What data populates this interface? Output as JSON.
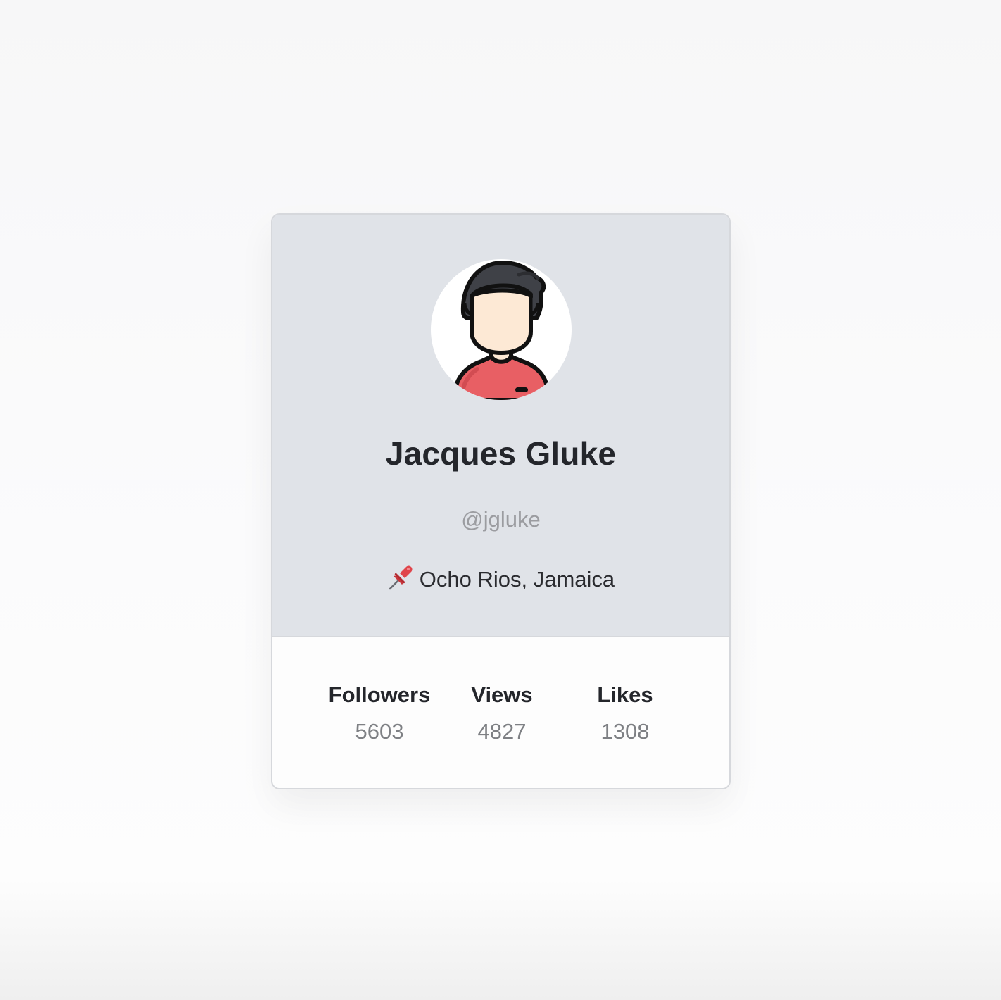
{
  "profile": {
    "name": "Jacques Gluke",
    "handle": "@jgluke",
    "location": "Ocho Rios, Jamaica",
    "location_icon": "pushpin-icon",
    "avatar_icon": "user-avatar-icon"
  },
  "stats": [
    {
      "label": "Followers",
      "value": "5603"
    },
    {
      "label": "Views",
      "value": "4827"
    },
    {
      "label": "Likes",
      "value": "1308"
    }
  ],
  "colors": {
    "card_header_bg": "#e0e3e8",
    "shirt": "#e85f64",
    "hair": "#3f4147",
    "skin": "#fde9d5"
  }
}
